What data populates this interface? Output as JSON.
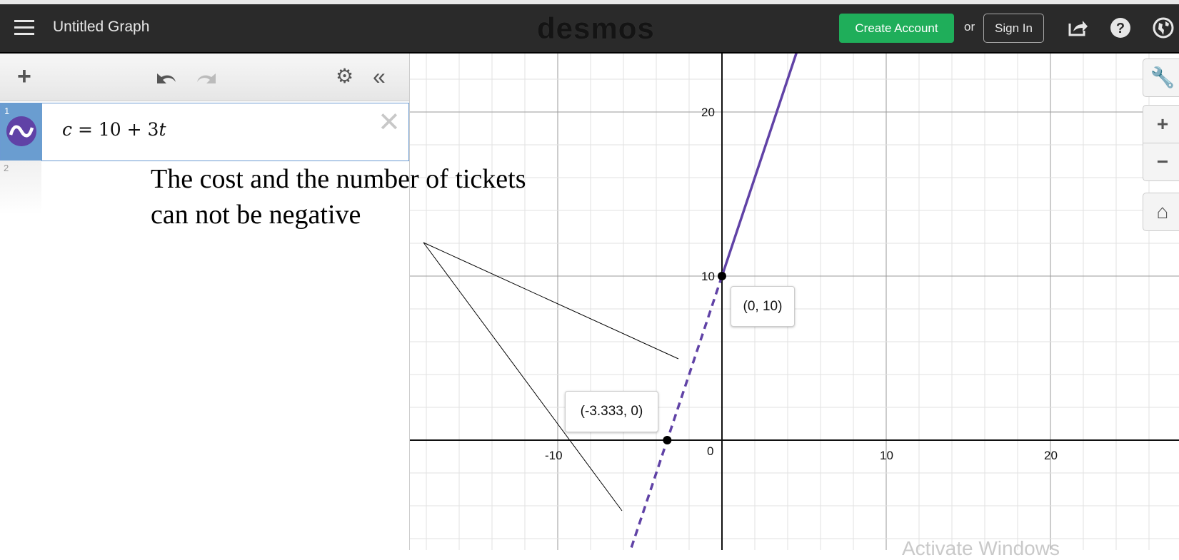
{
  "header": {
    "title": "Untitled Graph",
    "logo": "desmos",
    "create_account": "Create Account",
    "or": "or",
    "sign_in": "Sign In",
    "icons": [
      "menu-icon",
      "share-icon",
      "help-icon",
      "globe-icon"
    ],
    "create_color": "#1fae5a"
  },
  "panel": {
    "toolbar_icons": [
      "add-icon",
      "undo-icon",
      "redo-icon",
      "gear-icon",
      "collapse-icon"
    ],
    "expressions": [
      {
        "number": "1",
        "latex_lhs": "c",
        "latex_eq": "=",
        "latex_rhs_const": "10",
        "latex_plus": "+",
        "latex_coef": "3",
        "latex_var": "t",
        "color": "#6042a6"
      },
      {
        "number": "2"
      }
    ]
  },
  "annotation": {
    "line1": "The cost and the number of tickets",
    "line2": "can not be negative"
  },
  "graph": {
    "x_range": [
      -19,
      27.8
    ],
    "y_range": [
      -6.7,
      23.6
    ],
    "minor_grid_step": 2,
    "major_grid_step": 10,
    "x_ticks": [
      "-10",
      "0",
      "10",
      "20"
    ],
    "y_ticks": [
      "10",
      "20"
    ],
    "line": {
      "slope": 3,
      "intercept": 10,
      "color": "#6042a6",
      "solid_from_x": 0,
      "dashed_below_x": 0
    },
    "points": [
      {
        "x": 0,
        "y": 10,
        "label": "(0, 10)"
      },
      {
        "x": -3.333,
        "y": 0,
        "label": "(-3.333, 0)"
      }
    ]
  },
  "controls": {
    "icons": [
      "wrench-icon",
      "zoom-in-icon",
      "zoom-out-icon",
      "home-icon"
    ]
  },
  "watermark": "Activate Windows"
}
